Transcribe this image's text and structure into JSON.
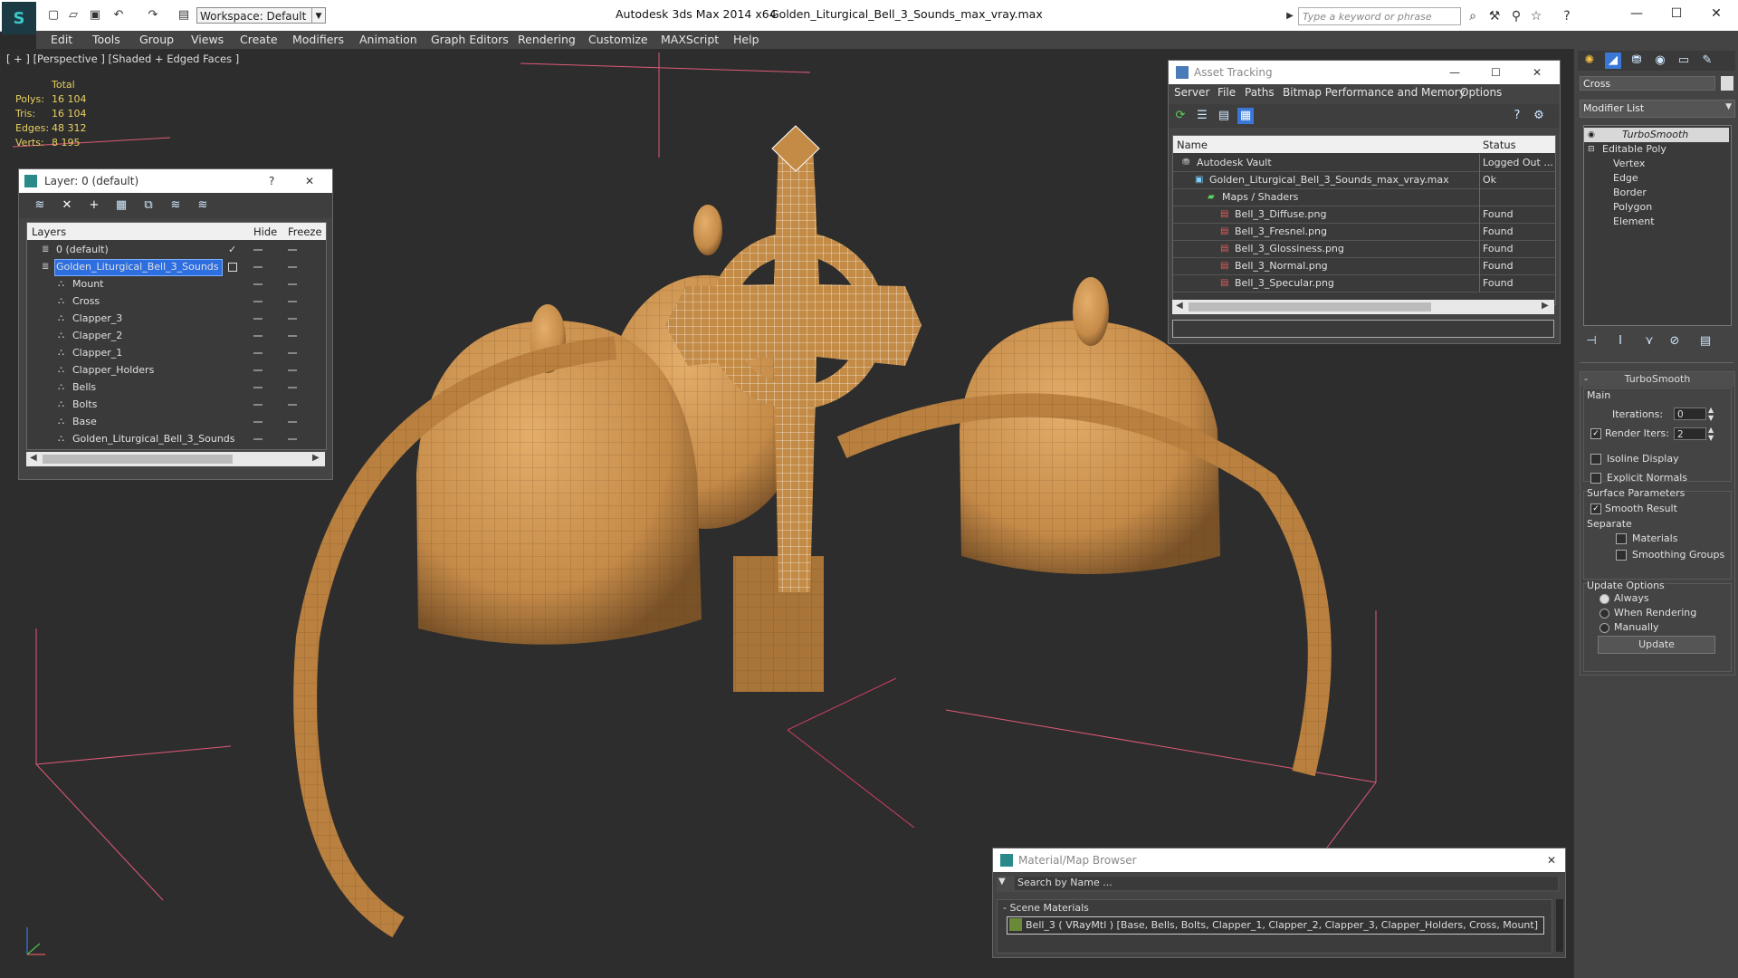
{
  "titlebar": {
    "app_title": "Autodesk 3ds Max  2014 x64",
    "file_title": "Golden_Liturgical_Bell_3_Sounds_max_vray.max",
    "workspace": "Workspace: Default",
    "search_placeholder": "Type a keyword or phrase"
  },
  "menu": [
    "Edit",
    "Tools",
    "Group",
    "Views",
    "Create",
    "Modifiers",
    "Animation",
    "Graph Editors",
    "Rendering",
    "Customize",
    "MAXScript",
    "Help"
  ],
  "viewport": {
    "label": "[ + ] [Perspective ] [Shaded + Edged Faces ]",
    "stats_header": "Total",
    "stats": [
      {
        "label": "Polys:",
        "value": "16 104"
      },
      {
        "label": "Tris:",
        "value": "16 104"
      },
      {
        "label": "Edges:",
        "value": "48 312"
      },
      {
        "label": "Verts:",
        "value": "8 195"
      }
    ]
  },
  "layer_panel": {
    "title": "Layer: 0 (default)",
    "help": "?",
    "columns": {
      "layers": "Layers",
      "hide": "Hide",
      "freeze": "Freeze"
    },
    "rows": [
      {
        "name": "0 (default)",
        "indent": 1,
        "selected": false
      },
      {
        "name": "Golden_Liturgical_Bell_3_Sounds",
        "indent": 1,
        "selected": true
      },
      {
        "name": "Mount",
        "indent": 2,
        "selected": false
      },
      {
        "name": "Cross",
        "indent": 2,
        "selected": false
      },
      {
        "name": "Clapper_3",
        "indent": 2,
        "selected": false
      },
      {
        "name": "Clapper_2",
        "indent": 2,
        "selected": false
      },
      {
        "name": "Clapper_1",
        "indent": 2,
        "selected": false
      },
      {
        "name": "Clapper_Holders",
        "indent": 2,
        "selected": false
      },
      {
        "name": "Bells",
        "indent": 2,
        "selected": false
      },
      {
        "name": "Bolts",
        "indent": 2,
        "selected": false
      },
      {
        "name": "Base",
        "indent": 2,
        "selected": false
      },
      {
        "name": "Golden_Liturgical_Bell_3_Sounds",
        "indent": 2,
        "selected": false
      }
    ]
  },
  "asset_panel": {
    "title": "Asset Tracking",
    "menu": [
      "Server",
      "File",
      "Paths",
      "Bitmap Performance and Memory",
      "Options"
    ],
    "columns": {
      "name": "Name",
      "status": "Status"
    },
    "rows": [
      {
        "name": "Autodesk Vault",
        "status": "Logged Out ...",
        "indent": 1,
        "icon": "vault"
      },
      {
        "name": "Golden_Liturgical_Bell_3_Sounds_max_vray.max",
        "status": "Ok",
        "indent": 2,
        "icon": "max"
      },
      {
        "name": "Maps / Shaders",
        "status": "",
        "indent": 3,
        "icon": "maps"
      },
      {
        "name": "Bell_3_Diffuse.png",
        "status": "Found",
        "indent": 4,
        "icon": "png"
      },
      {
        "name": "Bell_3_Fresnel.png",
        "status": "Found",
        "indent": 4,
        "icon": "png"
      },
      {
        "name": "Bell_3_Glossiness.png",
        "status": "Found",
        "indent": 4,
        "icon": "png"
      },
      {
        "name": "Bell_3_Normal.png",
        "status": "Found",
        "indent": 4,
        "icon": "png"
      },
      {
        "name": "Bell_3_Specular.png",
        "status": "Found",
        "indent": 4,
        "icon": "png"
      }
    ]
  },
  "material_panel": {
    "title": "Material/Map Browser",
    "search": "Search by Name ...",
    "section": "- Scene Materials",
    "item": "Bell_3  ( VRayMtl ) [Base, Bells, Bolts, Clapper_1, Clapper_2, Clapper_3, Clapper_Holders, Cross, Mount]"
  },
  "command_panel": {
    "object_name": "Cross",
    "modifier_list": "Modifier List",
    "stack": [
      {
        "name": "TurboSmooth",
        "level": 0
      },
      {
        "name": "Editable Poly",
        "level": 0
      },
      {
        "name": "Vertex",
        "level": 1
      },
      {
        "name": "Edge",
        "level": 1
      },
      {
        "name": "Border",
        "level": 1
      },
      {
        "name": "Polygon",
        "level": 1
      },
      {
        "name": "Element",
        "level": 1
      }
    ],
    "rollout_title": "TurboSmooth",
    "main_label": "Main",
    "iterations_label": "Iterations:",
    "iterations_value": "0",
    "render_iters_label": "Render Iters:",
    "render_iters_value": "2",
    "render_iters_checked": true,
    "isoline_label": "Isoline Display",
    "explicit_label": "Explicit Normals",
    "surface_label": "Surface Parameters",
    "smooth_label": "Smooth Result",
    "smooth_checked": true,
    "separate_label": "Separate",
    "materials_label": "Materials",
    "smoothing_groups_label": "Smoothing Groups",
    "update_options_label": "Update Options",
    "always_label": "Always",
    "when_rendering_label": "When Rendering",
    "manually_label": "Manually",
    "update_button": "Update"
  },
  "colors": {
    "accent": "#3a78d8",
    "mesh": "#c8904c",
    "grid_lines": "#e05a78"
  }
}
